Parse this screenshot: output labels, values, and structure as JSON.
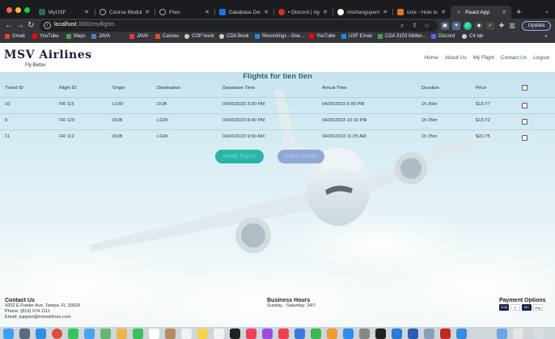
{
  "browser": {
    "tabs": [
      {
        "label": "MyUSF",
        "fav_color": "#2d6a4f"
      },
      {
        "label": "Course Modules",
        "fav_color": "#444"
      },
      {
        "label": "Files",
        "fav_color": "#444"
      },
      {
        "label": "Database Design",
        "fav_color": "#1a73e8"
      },
      {
        "label": "• Discord | #gene",
        "fav_color": "#d93025"
      },
      {
        "label": "mishanguyen/Dat",
        "fav_color": "#fff"
      },
      {
        "label": "unix - How to kill",
        "fav_color": "#e8711a"
      },
      {
        "label": "React App",
        "fav_color": "#61dafb"
      }
    ],
    "active_tab": 7,
    "url_host": "localhost",
    "url_path": ":3000/myflights",
    "update_label": "Update",
    "bookmarks": [
      {
        "label": "Gmail",
        "color": "#ea4335"
      },
      {
        "label": "YouTube",
        "color": "#ff0000"
      },
      {
        "label": "Maps",
        "color": "#34a853"
      },
      {
        "label": "JAVA",
        "color": "#5b7cc0"
      },
      {
        "label": "JAVA",
        "color": "#e53935"
      },
      {
        "label": "Canvas",
        "color": "#e2492f"
      },
      {
        "label": "COP book",
        "color": "#ccc"
      },
      {
        "label": "CDA Book",
        "color": "#ccc"
      },
      {
        "label": "Recordings - One...",
        "color": "#1e88e5"
      },
      {
        "label": "YouTube",
        "color": "#ff0000"
      },
      {
        "label": "USF Email",
        "color": "#1e88e5"
      },
      {
        "label": "CDA 3103 Midter...",
        "color": "#43a047"
      },
      {
        "label": "Discord",
        "color": "#5865f2"
      },
      {
        "label": "C4 lab",
        "color": "#ccc"
      }
    ]
  },
  "site": {
    "logo": "MSV Airlines",
    "tagline": "Fly Better",
    "nav": [
      "Home",
      "About Us",
      "My Flight",
      "Contact Us",
      "Logout"
    ]
  },
  "page_title": "Flights for tien tien",
  "table": {
    "headers": [
      "Ticket ID",
      "Flight ID",
      "Origin",
      "Destination",
      "Departure Time",
      "Arrival Time",
      "Duration",
      "Price"
    ],
    "rows": [
      [
        "10",
        "FR 115",
        "LGW",
        "DUB",
        "04/26/2023 3:30 PM",
        "04/26/2023 5:00 PM",
        "1h 30m",
        "$19.77"
      ],
      [
        "9",
        "FR 120",
        "DUB",
        "LGW",
        "04/26/2023 8:40 PM",
        "04/26/2023 10:15 PM",
        "1h 35m",
        "$19.72"
      ],
      [
        "11",
        "FR 112",
        "DUB",
        "LGW",
        "04/26/2023 9:50 AM",
        "04/26/2023 11:25 AM",
        "1h 35m",
        "$20.75"
      ]
    ]
  },
  "buttons": {
    "modify": "Modify Flights",
    "delete": "Delete Flights"
  },
  "footer": {
    "contact_heading": "Contact Us",
    "address": "4202 E Fowler Ave, Tampa, FL 33620",
    "phone": "Phone: (813) 974 1111",
    "email": "Email: support@msvairlines.com",
    "hours_heading": "Business Hours",
    "hours": "Sunday - Saturday: 24/7",
    "payment_heading": "Payment Options",
    "payment_methods": [
      "VISA",
      "P",
      "MC",
      "Pay"
    ]
  }
}
